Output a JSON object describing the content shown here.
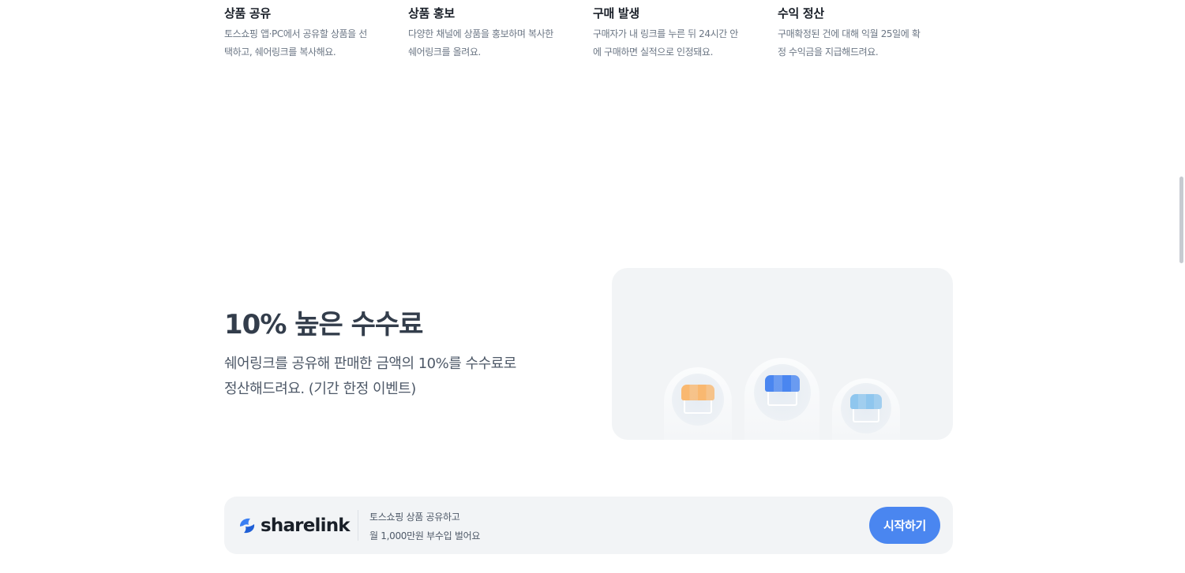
{
  "steps": [
    {
      "title": "상품 공유",
      "line1": "토스쇼핑 앱·PC에서 공유할 상품을 선",
      "line2": "택하고, 쉐어링크를 복사해요."
    },
    {
      "title": "상품 홍보",
      "line1": "다양한 채널에 상품을 홍보하며 복사한",
      "line2": "쉐어링크를 올려요."
    },
    {
      "title": "구매 발생",
      "line1": "구매자가 내 링크를 누른 뒤 24시간 안",
      "line2": "에 구매하면 실적으로 인정돼요."
    },
    {
      "title": "수익 정산",
      "line1": "구매확정된 건에 대해 익월 25일에 확",
      "line2": "정 수익금을 지급해드려요."
    }
  ],
  "feature": {
    "title": "10% 높은 수수료",
    "desc_line1": "쉐어링크를 공유해 판매한 금액의 10%를 수수료로",
    "desc_line2": "정산해드려요. (기간 한정 이벤트)",
    "illustration": {
      "stores": [
        {
          "icon": "store-icon",
          "color": "#f9b870"
        },
        {
          "icon": "store-icon",
          "color": "#4a86f0"
        },
        {
          "icon": "store-icon",
          "color": "#8fc6ee"
        }
      ]
    }
  },
  "banner": {
    "logo_text": "sharelink",
    "logo_color": "#3b7ff2",
    "line1": "토스쇼핑 상품 공유하고",
    "line2": "월 1,000만원 부수입 벌어요",
    "button_label": "시작하기",
    "button_color": "#4a86f0"
  }
}
